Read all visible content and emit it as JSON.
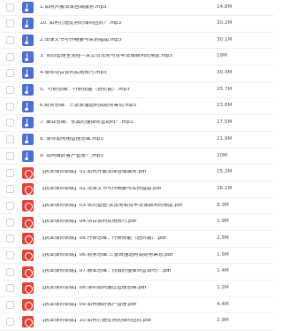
{
  "files": [
    {
      "name": "1.如何开展法律咨询服务.mp3",
      "size": "14.8M",
      "type": "audio"
    },
    {
      "name": "10. 如何打造优秀的律师团队？.mp3",
      "size": "30.2M",
      "type": "audio"
    },
    {
      "name": "2.法律文书写作精要与实例指南.mp3",
      "size": "30.1M",
      "type": "audio"
    },
    {
      "name": "3. 合同管理全流程—从公司法务与常年法律顾问的角度.mp3",
      "size": "19M",
      "type": "audio"
    },
    {
      "name": "4.律师项目谈判实用技巧.mp3",
      "size": "30.4M",
      "type": "audio"
    },
    {
      "name": "5．行研思维：行研技能（进阶篇）.mp3",
      "size": "25.7M",
      "type": "audio"
    },
    {
      "name": "6.财务思维：三张表懂透利润财务筹划.mp3",
      "size": "23.8M",
      "type": "audio"
    },
    {
      "name": "7. 商业思维：你真的懂律师营销吗？.mp3",
      "size": "17.5M",
      "type": "audio"
    },
    {
      "name": "8. 律师如何用管理思维.mp3",
      "size": "21.9M",
      "type": "audio"
    },
    {
      "name": "9. 如何做好客户管理？.mp3",
      "size": "20M",
      "type": "audio"
    },
    {
      "name": "【执业律师训练】01.如何开展法律咨询服务.pdf",
      "size": "15.2M",
      "type": "pdf"
    },
    {
      "name": "【执业律师训练】02.法律文书写作精要与实例指南.pdf",
      "size": "26.1M",
      "type": "pdf"
    },
    {
      "name": "【执业律师训练】03.合同管理:从法务和常年法律顾问的角度.pdf",
      "size": "8.3M",
      "type": "pdf"
    },
    {
      "name": "【执业律师训练】04.项目谈判实用技巧.pdf",
      "size": "1.9M",
      "type": "pdf"
    },
    {
      "name": "【执业律师训练】05.行研思维：行研技能（进阶篇）.pdf",
      "size": "2.5M",
      "type": "pdf"
    },
    {
      "name": "【执业律师训练】06.财务思维:三张表懂透利润财务筹划.pdf",
      "size": "1.5M",
      "type": "pdf"
    },
    {
      "name": "【执业律师训练】07.商业思维：你真的懂律师营销吗？.pdf",
      "size": "1.4M",
      "type": "pdf"
    },
    {
      "name": "【执业律师训练】08.律师如何通过管理思维.pdf",
      "size": "1.2M",
      "type": "pdf"
    },
    {
      "name": "【执业律师训练】09.如何做好客户管理.pdf",
      "size": "4.4M",
      "type": "pdf"
    },
    {
      "name": "【执业律师训练】10.如何打造优秀的律师团队.pdf",
      "size": "2.9M",
      "type": "pdf"
    }
  ]
}
